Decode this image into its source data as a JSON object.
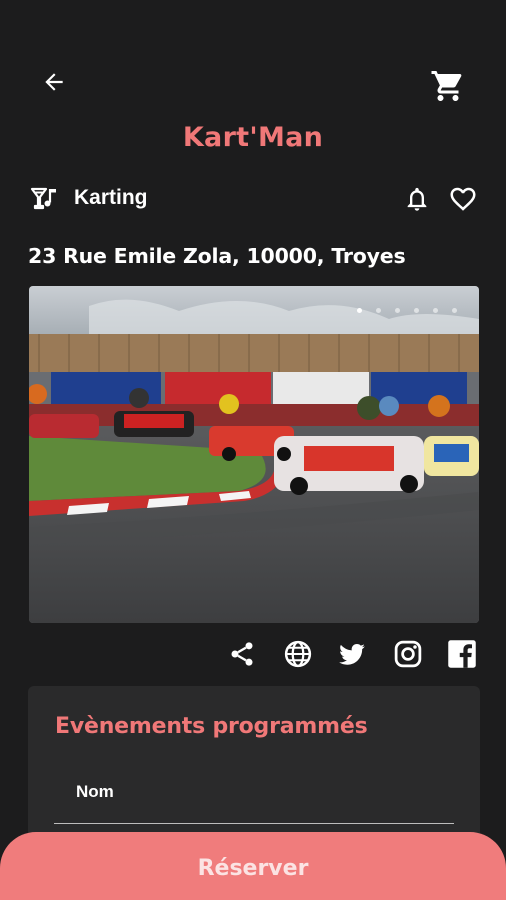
{
  "header": {
    "title": "Kart'Man",
    "back_icon": "arrow-left-icon",
    "cart_icon": "shopping-cart-icon"
  },
  "place": {
    "category": "Karting",
    "category_icon": "cocktail-music-icon",
    "address": "23 Rue Emile Zola, 10000, Troyes",
    "notification_icon": "bell-icon",
    "favorite_icon": "heart-icon"
  },
  "gallery": {
    "slide_count": 6,
    "active_slide": 1
  },
  "social": [
    "share-icon",
    "globe-icon",
    "twitter-icon",
    "instagram-icon",
    "facebook-icon"
  ],
  "events": {
    "title": "Evènements programmés",
    "columns": [
      "Nom"
    ]
  },
  "footer": {
    "reserve_label": "Réserver"
  },
  "colors": {
    "background": "#1c1c1d",
    "accent": "#f07878",
    "panel": "#2a2a2b",
    "button": "#f07c7c"
  }
}
